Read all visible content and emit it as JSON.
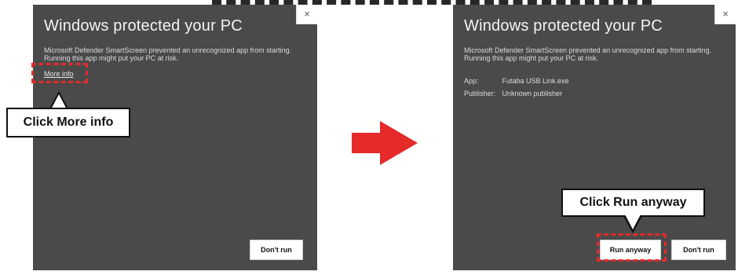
{
  "left_dialog": {
    "close": "×",
    "title": "Windows protected your PC",
    "description": "Microsoft Defender SmartScreen prevented an unrecognized app from starting. Running this app might put your PC at risk.",
    "more_info": "More info",
    "dont_run": "Don't run"
  },
  "right_dialog": {
    "close": "×",
    "title": "Windows protected your PC",
    "description": "Microsoft Defender SmartScreen prevented an unrecognized app from starting. Running this app might put your PC at risk.",
    "app_label": "App:",
    "app_value": "Futaba USB Link.exe",
    "publisher_label": "Publisher:",
    "publisher_value": "Unknown publisher",
    "run_anyway": "Run anyway",
    "dont_run": "Don't run"
  },
  "callouts": {
    "more_info": "Click More info",
    "run_anyway": "Click Run anyway"
  },
  "colors": {
    "dialog_bg": "#4a4a4a",
    "highlight": "#e52a2a",
    "arrow": "#e52a2a"
  },
  "icons": {
    "close": "close-icon",
    "arrow": "arrow-right-icon"
  }
}
